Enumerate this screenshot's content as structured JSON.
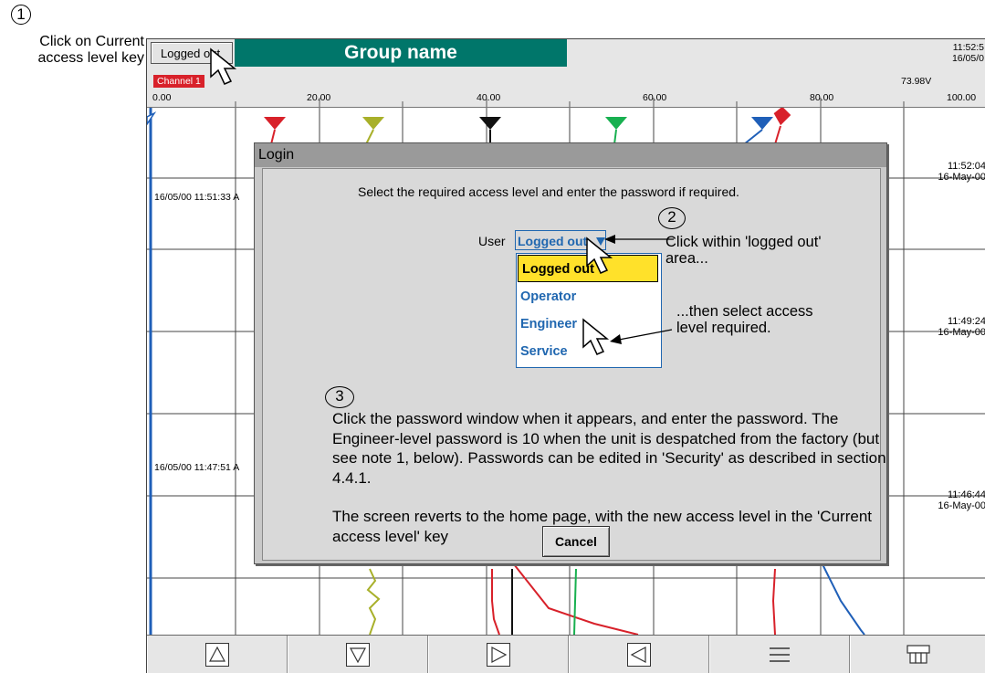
{
  "annotations": {
    "step1_number": "1",
    "step1_text": "Click on Current access level key",
    "step2_number": "2",
    "step2_text": "Click within 'logged out' area...",
    "step2b_text": "...then select access level required.",
    "step3_number": "3",
    "step3_text": "Click the password window when it appears, and enter the password. The Engineer-level password is 10 when the unit is despatched from the factory (but see note 1, below). Passwords can be edited in 'Security' as described in section 4.4.1.",
    "step3b_text": "The screen reverts to the home page, with the new access level in the 'Current access level' key"
  },
  "header": {
    "access_key_label": "Logged out",
    "group_name": "Group name",
    "time": "11:52:5",
    "date": "16/05/0"
  },
  "scale": {
    "channel_label": "Channel 1",
    "channel_value": "73.98V",
    "ticks": [
      "0.00",
      "20.00",
      "40.00",
      "60.00",
      "80.00",
      "100.00"
    ]
  },
  "chart": {
    "left_timestamps": [
      "16/05/00 11:51:33 A",
      "16/05/00 11:47:51 A"
    ],
    "right_timestamps": [
      {
        "time": "11:52:04",
        "date": "16-May-00"
      },
      {
        "time": "11:49:24",
        "date": "16-May-00"
      },
      {
        "time": "11:46:44",
        "date": "16-May-00"
      }
    ],
    "series_colors": [
      "#d8212a",
      "#a8b02a",
      "#111111",
      "#18b050",
      "#1f5fb8"
    ]
  },
  "login": {
    "title": "Login",
    "prompt": "Select the required access level and enter the password if required.",
    "user_label": "User",
    "user_value": "Logged out",
    "options": [
      "Logged out",
      "Operator",
      "Engineer",
      "Service"
    ],
    "cancel_label": "Cancel"
  },
  "softkeys": [
    "up-icon",
    "down-icon",
    "right-icon",
    "left-icon",
    "menu-icon",
    "layout-icon"
  ]
}
